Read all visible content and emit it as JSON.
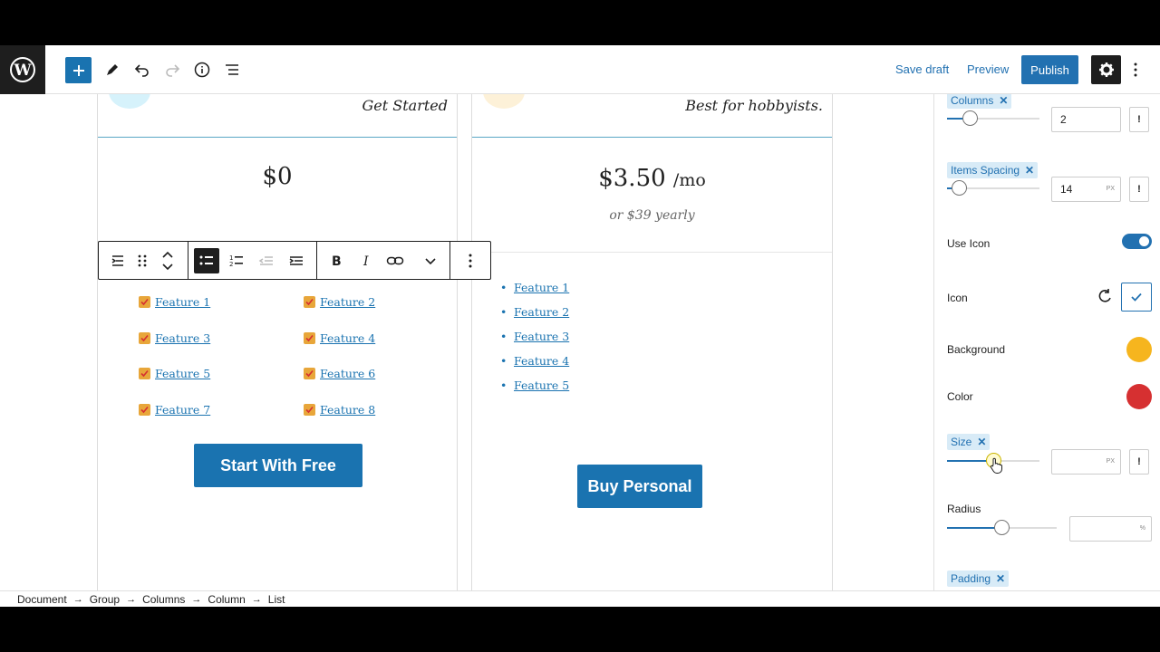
{
  "toolbar": {
    "save_draft": "Save draft",
    "preview": "Preview",
    "publish": "Publish"
  },
  "plans": [
    {
      "subtitle": "Get Started",
      "price": "$0",
      "features": [
        "Feature 1",
        "Feature 2",
        "Feature 3",
        "Feature 4",
        "Feature 5",
        "Feature 6",
        "Feature 7",
        "Feature 8"
      ],
      "cta": "Start With Free"
    },
    {
      "subtitle": "Best for hobbyists.",
      "price": "$3.50",
      "price_suffix": "/mo",
      "yearly": "or $39 yearly",
      "features": [
        "Feature 1",
        "Feature 2",
        "Feature 3",
        "Feature 4",
        "Feature 5"
      ],
      "cta": "Buy Personal"
    }
  ],
  "sidebar": {
    "columns": {
      "label": "Columns",
      "value": "2",
      "level": 0.25
    },
    "items_spacing": {
      "label": "Items Spacing",
      "value": "14",
      "unit": "PX",
      "level": 0.14
    },
    "use_icon": {
      "label": "Use Icon",
      "on": true
    },
    "icon": {
      "label": "Icon"
    },
    "background": {
      "label": "Background",
      "color": "#f6b51e"
    },
    "color": {
      "label": "Color",
      "color": "#d63031"
    },
    "size": {
      "label": "Size",
      "value": "",
      "unit": "PX",
      "level": 0.5
    },
    "radius": {
      "label": "Radius",
      "value": "",
      "unit": "%",
      "level": 0.5
    },
    "padding": {
      "label": "Padding"
    },
    "warn_symbol": "!"
  },
  "breadcrumb": [
    "Document",
    "Group",
    "Columns",
    "Column",
    "List"
  ],
  "colors": {
    "accent": "#2271b1",
    "check": "#e8a63a",
    "dark": "#1e1e1e"
  }
}
